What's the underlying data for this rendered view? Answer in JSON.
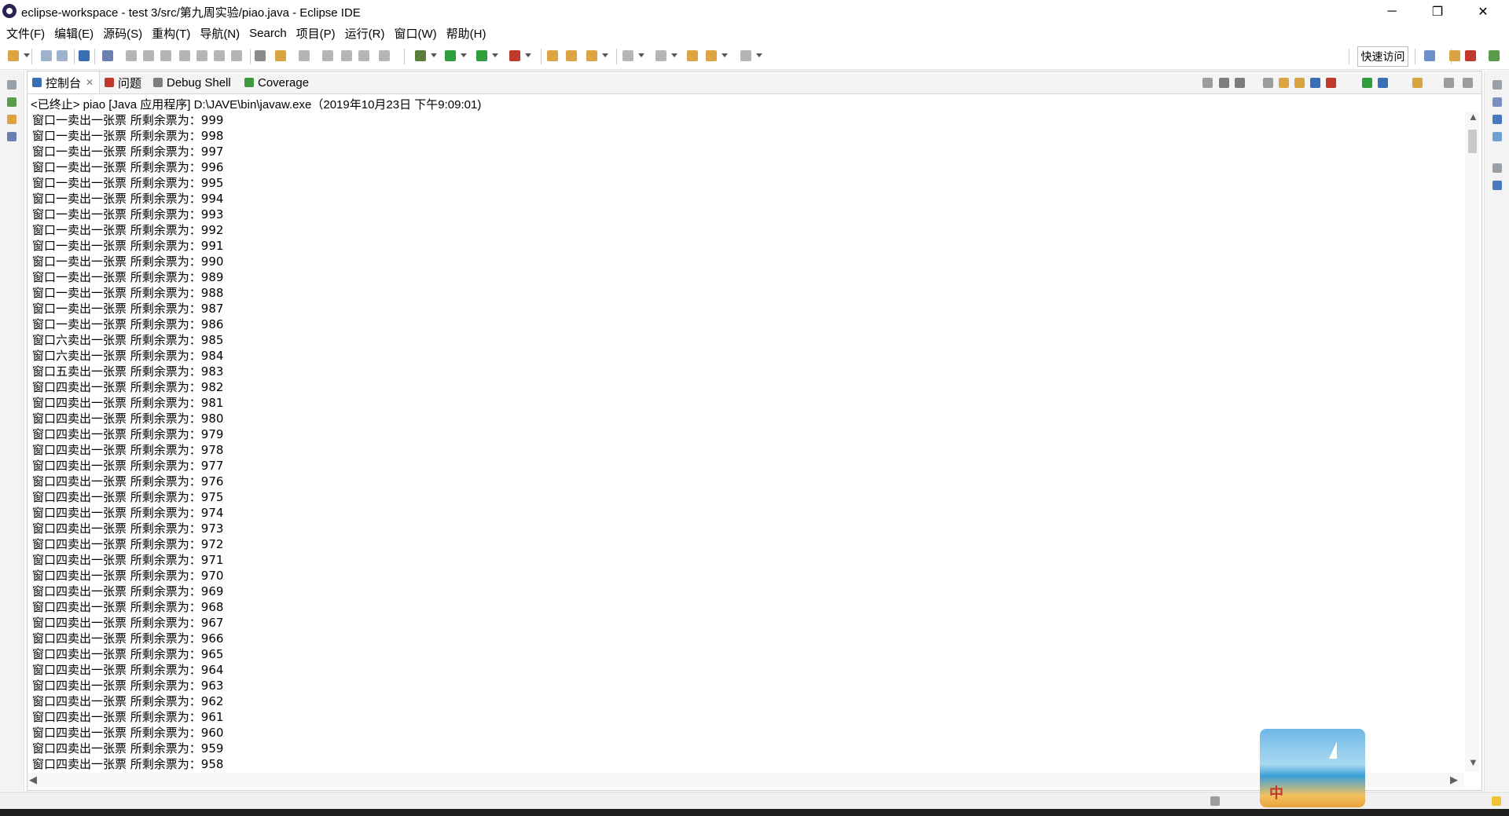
{
  "window": {
    "title": "eclipse-workspace - test 3/src/第九周实验/piao.java - Eclipse IDE",
    "minimize": "─",
    "maximize": "❐",
    "close": "✕"
  },
  "menu": [
    "文件(F)",
    "编辑(E)",
    "源码(S)",
    "重构(T)",
    "导航(N)",
    "Search",
    "项目(P)",
    "运行(R)",
    "窗口(W)",
    "帮助(H)"
  ],
  "toolbar": {
    "quick_access": "快速访问"
  },
  "tabs": [
    {
      "label": "控制台",
      "active": true,
      "close": "✕"
    },
    {
      "label": "问题",
      "active": false
    },
    {
      "label": "Debug Shell",
      "active": false
    },
    {
      "label": "Coverage",
      "active": false
    }
  ],
  "console": {
    "header": "<已终止> piao [Java 应用程序] D:\\JAVE\\bin\\javaw.exe（2019年10月23日 下午9:09:01)",
    "lines": [
      "窗口一卖出一张票 所剩余票为：999",
      "窗口一卖出一张票 所剩余票为：998",
      "窗口一卖出一张票 所剩余票为：997",
      "窗口一卖出一张票 所剩余票为：996",
      "窗口一卖出一张票 所剩余票为：995",
      "窗口一卖出一张票 所剩余票为：994",
      "窗口一卖出一张票 所剩余票为：993",
      "窗口一卖出一张票 所剩余票为：992",
      "窗口一卖出一张票 所剩余票为：991",
      "窗口一卖出一张票 所剩余票为：990",
      "窗口一卖出一张票 所剩余票为：989",
      "窗口一卖出一张票 所剩余票为：988",
      "窗口一卖出一张票 所剩余票为：987",
      "窗口一卖出一张票 所剩余票为：986",
      "窗口六卖出一张票 所剩余票为：985",
      "窗口六卖出一张票 所剩余票为：984",
      "窗口五卖出一张票 所剩余票为：983",
      "窗口四卖出一张票 所剩余票为：982",
      "窗口四卖出一张票 所剩余票为：981",
      "窗口四卖出一张票 所剩余票为：980",
      "窗口四卖出一张票 所剩余票为：979",
      "窗口四卖出一张票 所剩余票为：978",
      "窗口四卖出一张票 所剩余票为：977",
      "窗口四卖出一张票 所剩余票为：976",
      "窗口四卖出一张票 所剩余票为：975",
      "窗口四卖出一张票 所剩余票为：974",
      "窗口四卖出一张票 所剩余票为：973",
      "窗口四卖出一张票 所剩余票为：972",
      "窗口四卖出一张票 所剩余票为：971",
      "窗口四卖出一张票 所剩余票为：970",
      "窗口四卖出一张票 所剩余票为：969",
      "窗口四卖出一张票 所剩余票为：968",
      "窗口四卖出一张票 所剩余票为：967",
      "窗口四卖出一张票 所剩余票为：966",
      "窗口四卖出一张票 所剩余票为：965",
      "窗口四卖出一张票 所剩余票为：964",
      "窗口四卖出一张票 所剩余票为：963",
      "窗口四卖出一张票 所剩余票为：962",
      "窗口四卖出一张票 所剩余票为：961",
      "窗口四卖出一张票 所剩余票为：960",
      "窗口四卖出一张票 所剩余票为：959",
      "窗口四卖出一张票 所剩余票为：958"
    ]
  },
  "scroll": {
    "up": "▲",
    "down": "▼",
    "left": "◀",
    "right": "▶"
  },
  "ime": {
    "label": "中"
  },
  "colors": {
    "accent": "#1f64c8",
    "tab_bar": "#f4f4f4",
    "status": "#f0f0f0"
  }
}
